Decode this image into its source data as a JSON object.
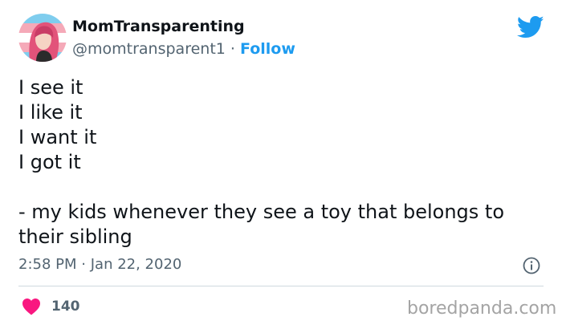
{
  "author": {
    "display_name": "MomTransparenting",
    "handle": "@momtransparent1",
    "separator": "·",
    "follow_label": "Follow",
    "avatar_icon": "avatar-illustration"
  },
  "tweet": {
    "lines": [
      "I see it",
      "I like it",
      "I want it",
      "I got it"
    ],
    "quote": "- my kids whenever they see a toy that belongs to their sibling",
    "time": "2:58 PM",
    "date_separator": "·",
    "date": "Jan 22, 2020"
  },
  "engagement": {
    "likes": "140",
    "like_icon": "heart-icon"
  },
  "icons": {
    "brand": "twitter-bird-icon",
    "info": "info-icon"
  },
  "watermark": "boredpanda.com",
  "colors": {
    "accent": "#1d9bf0",
    "heart": "#f91880",
    "text": "#0f1419",
    "muted": "#536471",
    "divider": "#cfd9de"
  }
}
